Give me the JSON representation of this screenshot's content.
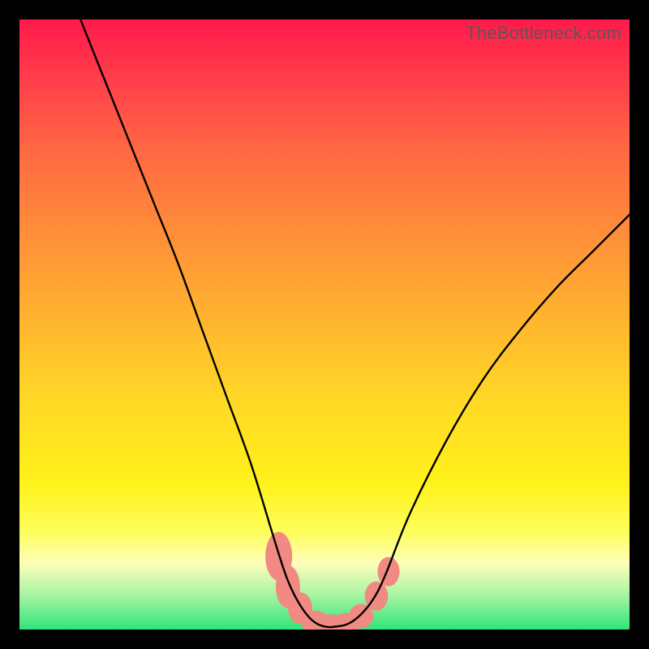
{
  "watermark": "TheBottleneck.com",
  "chart_data": {
    "type": "line",
    "title": "",
    "xlabel": "",
    "ylabel": "",
    "xlim": [
      0,
      100
    ],
    "ylim": [
      0,
      100
    ],
    "series": [
      {
        "name": "bottleneck-curve",
        "color": "#000000",
        "x": [
          10,
          14,
          18,
          22,
          26,
          30,
          34,
          38,
          42,
          44,
          46,
          48,
          50,
          52,
          54,
          56,
          58,
          60,
          64,
          70,
          76,
          82,
          88,
          94,
          100
        ],
        "y": [
          100,
          90,
          80,
          70,
          60,
          49,
          38,
          27,
          14,
          8,
          4,
          1.5,
          0.5,
          0.5,
          1,
          2.5,
          5,
          9,
          19,
          31,
          41,
          49,
          56,
          62,
          68
        ]
      }
    ],
    "markers": {
      "name": "salmon-blobs",
      "color": "#f08a82",
      "points": [
        {
          "x": 42.5,
          "y": 12,
          "rx": 2.2,
          "ry": 4
        },
        {
          "x": 44.0,
          "y": 7,
          "rx": 2.0,
          "ry": 3.5
        },
        {
          "x": 46.0,
          "y": 3.5,
          "rx": 2.0,
          "ry": 2.6
        },
        {
          "x": 48.5,
          "y": 1.2,
          "rx": 2.3,
          "ry": 1.9
        },
        {
          "x": 51.0,
          "y": 0.7,
          "rx": 2.6,
          "ry": 1.8
        },
        {
          "x": 53.5,
          "y": 0.9,
          "rx": 2.4,
          "ry": 1.8
        },
        {
          "x": 56.0,
          "y": 2.2,
          "rx": 2.0,
          "ry": 2.0
        },
        {
          "x": 58.5,
          "y": 5.5,
          "rx": 1.9,
          "ry": 2.4
        },
        {
          "x": 60.5,
          "y": 9.5,
          "rx": 1.8,
          "ry": 2.4
        }
      ]
    },
    "gradient_stops": [
      {
        "pos": 0.0,
        "color": "#ff1a4b"
      },
      {
        "pos": 0.1,
        "color": "#ff3f4a"
      },
      {
        "pos": 0.22,
        "color": "#ff6a42"
      },
      {
        "pos": 0.45,
        "color": "#ffa932"
      },
      {
        "pos": 0.62,
        "color": "#ffd726"
      },
      {
        "pos": 0.76,
        "color": "#fff21a"
      },
      {
        "pos": 0.84,
        "color": "#fdfe5b"
      },
      {
        "pos": 0.89,
        "color": "#fefeb9"
      },
      {
        "pos": 0.94,
        "color": "#aef5a5"
      },
      {
        "pos": 1.0,
        "color": "#2fe57a"
      }
    ]
  }
}
